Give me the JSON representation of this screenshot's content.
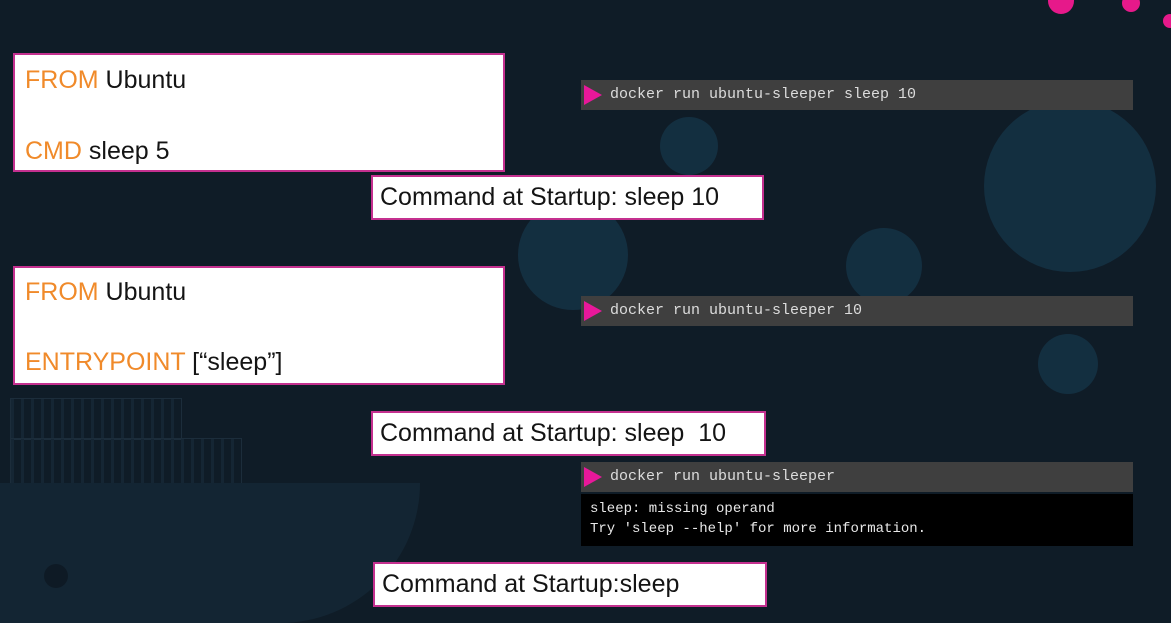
{
  "examples": [
    {
      "dockerfile": [
        {
          "keyword": "FROM",
          "arg": " Ubuntu"
        },
        {
          "keyword": "CMD",
          "arg": " sleep 5"
        }
      ],
      "terminal_command": "docker run ubuntu-sleeper sleep 10",
      "startup_text": "Command at Startup: sleep 10"
    },
    {
      "dockerfile": [
        {
          "keyword": "FROM",
          "arg": " Ubuntu"
        },
        {
          "keyword": "ENTRYPOINT",
          "arg": " [“sleep”]"
        }
      ],
      "terminal_command": "docker run ubuntu-sleeper 10",
      "startup_text": "Command at Startup: sleep  10"
    },
    {
      "terminal_command": "docker run ubuntu-sleeper",
      "output": [
        "sleep: missing operand",
        "Try 'sleep --help' for more information."
      ],
      "startup_text": "Command at Startup:sleep"
    }
  ],
  "colors": {
    "keyword": "#f08a2a",
    "border": "#c4308f",
    "prompt": "#e8189a",
    "background": "#0f1c27"
  },
  "icons": {
    "prompt": "prompt-triangle-icon",
    "logo": "docker-whale-icon"
  }
}
